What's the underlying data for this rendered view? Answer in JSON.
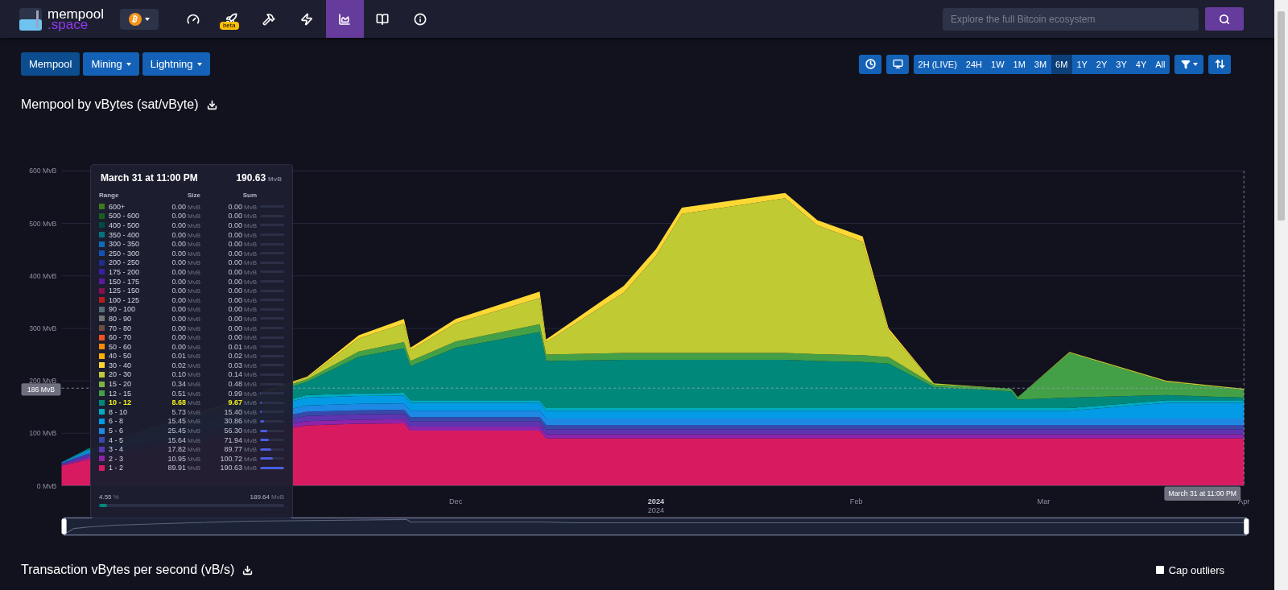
{
  "nav": {
    "logo": {
      "word": "mempool",
      "suffix": ".space"
    },
    "items": [
      {
        "kind": "dashboard",
        "selected": false
      },
      {
        "kind": "accelerator",
        "selected": false,
        "badge": "beta"
      },
      {
        "kind": "mining",
        "selected": false
      },
      {
        "kind": "lightning",
        "selected": false
      },
      {
        "kind": "graphs",
        "selected": true
      },
      {
        "kind": "docs",
        "selected": false
      },
      {
        "kind": "about",
        "selected": false
      }
    ],
    "search": {
      "placeholder": "Explore the full Bitcoin ecosystem"
    }
  },
  "sections": [
    {
      "label": "Mempool",
      "selected": true,
      "dropdown": false
    },
    {
      "label": "Mining",
      "selected": false,
      "dropdown": true
    },
    {
      "label": "Lightning",
      "selected": false,
      "dropdown": true
    }
  ],
  "ranges": [
    {
      "label": "2H (LIVE)",
      "selected": false
    },
    {
      "label": "24H",
      "selected": false
    },
    {
      "label": "1W",
      "selected": false
    },
    {
      "label": "1M",
      "selected": false
    },
    {
      "label": "3M",
      "selected": false
    },
    {
      "label": "6M",
      "selected": true
    },
    {
      "label": "1Y",
      "selected": false
    },
    {
      "label": "2Y",
      "selected": false
    },
    {
      "label": "3Y",
      "selected": false
    },
    {
      "label": "4Y",
      "selected": false
    },
    {
      "label": "All",
      "selected": false
    }
  ],
  "chart_title": "Mempool by vBytes (sat/vByte)",
  "chart": {
    "chart_data": {
      "type": "area",
      "stacked": true,
      "grid": true,
      "ref_lines": [
        {
          "axis": "y",
          "value": 186,
          "label": "186 MvB"
        },
        {
          "axis": "x",
          "value": "2024-04-01",
          "label": "March 31 at 11:00 PM"
        }
      ],
      "x": [
        "2023-10-01",
        "2023-10-05",
        "2023-11-08",
        "2023-11-16",
        "2023-11-23",
        "2023-11-24",
        "2023-12-01",
        "2023-12-14",
        "2023-12-15",
        "2023-12-27",
        "2024-01-01",
        "2024-01-05",
        "2024-01-21",
        "2024-01-26",
        "2024-02-02",
        "2024-02-06",
        "2024-02-13",
        "2024-02-25",
        "2024-02-26",
        "2024-03-05",
        "2024-03-20",
        "2024-04-01"
      ],
      "xlim": [
        "2023-10-01",
        "2024-04-01"
      ],
      "ylim": [
        0,
        600
      ],
      "xticks": [
        {
          "value": "2023-12-01",
          "label": "Dec"
        },
        {
          "value": "2024-01-01",
          "label": "2024"
        },
        {
          "value": "2024-02-01",
          "label": "Feb"
        },
        {
          "value": "2024-03-01",
          "label": "Mar"
        },
        {
          "value": "2024-04-01",
          "label": "Apr"
        }
      ],
      "yticks": [
        {
          "value": 0,
          "label": "0 MvB"
        },
        {
          "value": 100,
          "label": "100 MvB"
        },
        {
          "value": 200,
          "label": "200 MvB"
        },
        {
          "value": 300,
          "label": "300 MvB"
        },
        {
          "value": 400,
          "label": "400 MvB"
        },
        {
          "value": 500,
          "label": "500 MvB"
        },
        {
          "value": 600,
          "label": "600 MvB"
        }
      ],
      "series": [
        {
          "color": "#d81b60",
          "values": [
            38,
            50,
            115,
            118,
            119,
            105,
            105,
            105,
            90,
            90,
            90,
            90,
            90,
            90,
            90,
            90,
            90,
            90,
            90,
            90,
            90,
            90
          ]
        },
        {
          "color": "#8e24aa",
          "values": [
            2,
            4,
            8,
            8,
            8,
            8,
            8,
            8,
            8,
            8,
            8,
            8,
            8,
            8,
            8,
            8,
            8,
            8,
            8,
            8,
            8,
            8
          ]
        },
        {
          "color": "#5e35b1",
          "values": [
            2,
            4,
            10,
            10,
            10,
            10,
            10,
            10,
            10,
            10,
            10,
            10,
            10,
            10,
            10,
            10,
            10,
            10,
            10,
            10,
            10,
            10
          ]
        },
        {
          "color": "#3949ab",
          "values": [
            1,
            3,
            8,
            8,
            8,
            8,
            8,
            8,
            8,
            8,
            8,
            8,
            8,
            8,
            8,
            8,
            8,
            8,
            8,
            8,
            8,
            8
          ]
        },
        {
          "color": "#1e88e5",
          "values": [
            1,
            3,
            12,
            12,
            12,
            12,
            12,
            12,
            12,
            12,
            12,
            12,
            12,
            12,
            12,
            12,
            12,
            12,
            12,
            12,
            12,
            12
          ]
        },
        {
          "color": "#039be5",
          "values": [
            1,
            3,
            15,
            15,
            15,
            15,
            15,
            15,
            15,
            15,
            15,
            15,
            15,
            15,
            15,
            15,
            15,
            15,
            15,
            15,
            30,
            30
          ]
        },
        {
          "color": "#00acc1",
          "values": [
            0,
            1,
            5,
            5,
            5,
            5,
            5,
            5,
            5,
            5,
            5,
            5,
            5,
            5,
            5,
            5,
            5,
            5,
            5,
            5,
            5,
            5
          ]
        },
        {
          "color": "#00897b",
          "values": [
            0,
            2,
            25,
            70,
            85,
            65,
            100,
            130,
            90,
            92,
            92,
            92,
            92,
            90,
            88,
            85,
            40,
            32,
            16,
            20,
            10,
            5
          ]
        },
        {
          "color": "#43a047",
          "values": [
            0,
            0,
            5,
            10,
            12,
            10,
            12,
            15,
            12,
            13,
            13,
            13,
            13,
            13,
            13,
            12,
            5,
            5,
            5,
            85,
            25,
            15
          ]
        },
        {
          "color": "#c0ca33",
          "values": [
            0,
            0,
            3,
            25,
            35,
            20,
            35,
            50,
            24,
            115,
            185,
            265,
            295,
            245,
            216,
            50,
            2,
            0,
            0,
            2,
            2,
            2
          ]
        },
        {
          "color": "#fdd835",
          "values": [
            0,
            0,
            2,
            6,
            9,
            5,
            8,
            12,
            5,
            13,
            13,
            12,
            10,
            10,
            10,
            5,
            0,
            0,
            0,
            0,
            0,
            0
          ]
        }
      ]
    },
    "year_sublabel": "2024"
  },
  "tooltip": {
    "title": "March 31 at 11:00 PM",
    "total": "190.63",
    "total_unit": "MvB",
    "columns": [
      "Range",
      "Size",
      "Sum"
    ],
    "rows": [
      {
        "range": "600+",
        "color": "#3d7a1f",
        "size": "0.00",
        "size_unit": "MvB",
        "sum": "0.00",
        "sum_unit": "MvB",
        "level": 0,
        "selected": false
      },
      {
        "range": "500 - 600",
        "color": "#1b5e20",
        "size": "0.00",
        "size_unit": "MvB",
        "sum": "0.00",
        "sum_unit": "MvB",
        "level": 0,
        "selected": false
      },
      {
        "range": "400 - 500",
        "color": "#004d40",
        "size": "0.00",
        "size_unit": "MvB",
        "sum": "0.00",
        "sum_unit": "MvB",
        "level": 0,
        "selected": false
      },
      {
        "range": "350 - 400",
        "color": "#00757a",
        "size": "0.00",
        "size_unit": "MvB",
        "sum": "0.00",
        "sum_unit": "MvB",
        "level": 0,
        "selected": false
      },
      {
        "range": "300 - 350",
        "color": "#0d6bb8",
        "size": "0.00",
        "size_unit": "MvB",
        "sum": "0.00",
        "sum_unit": "MvB",
        "level": 0,
        "selected": false
      },
      {
        "range": "250 - 300",
        "color": "#1551b5",
        "size": "0.00",
        "size_unit": "MvB",
        "sum": "0.00",
        "sum_unit": "MvB",
        "level": 0,
        "selected": false
      },
      {
        "range": "200 - 250",
        "color": "#222c8e",
        "size": "0.00",
        "size_unit": "MvB",
        "sum": "0.00",
        "sum_unit": "MvB",
        "level": 0,
        "selected": false
      },
      {
        "range": "175 - 200",
        "color": "#3a1fa0",
        "size": "0.00",
        "size_unit": "MvB",
        "sum": "0.00",
        "sum_unit": "MvB",
        "level": 0,
        "selected": false
      },
      {
        "range": "150 - 175",
        "color": "#5a1a9c",
        "size": "0.00",
        "size_unit": "MvB",
        "sum": "0.00",
        "sum_unit": "MvB",
        "level": 0,
        "selected": false
      },
      {
        "range": "125 - 150",
        "color": "#880e4f",
        "size": "0.00",
        "size_unit": "MvB",
        "sum": "0.00",
        "sum_unit": "MvB",
        "level": 0,
        "selected": false
      },
      {
        "range": "100 - 125",
        "color": "#b71c1c",
        "size": "0.00",
        "size_unit": "MvB",
        "sum": "0.00",
        "sum_unit": "MvB",
        "level": 0,
        "selected": false
      },
      {
        "range": "90 - 100",
        "color": "#546e7a",
        "size": "0.00",
        "size_unit": "MvB",
        "sum": "0.00",
        "sum_unit": "MvB",
        "level": 0,
        "selected": false
      },
      {
        "range": "80 - 90",
        "color": "#757575",
        "size": "0.00",
        "size_unit": "MvB",
        "sum": "0.00",
        "sum_unit": "MvB",
        "level": 0,
        "selected": false
      },
      {
        "range": "70 - 80",
        "color": "#6d4c41",
        "size": "0.00",
        "size_unit": "MvB",
        "sum": "0.00",
        "sum_unit": "MvB",
        "level": 0,
        "selected": false
      },
      {
        "range": "60 - 70",
        "color": "#f4511e",
        "size": "0.00",
        "size_unit": "MvB",
        "sum": "0.00",
        "sum_unit": "MvB",
        "level": 0,
        "selected": false
      },
      {
        "range": "50 - 60",
        "color": "#fb8c00",
        "size": "0.00",
        "size_unit": "MvB",
        "sum": "0.01",
        "sum_unit": "MvB",
        "level": 0,
        "selected": false
      },
      {
        "range": "40 - 50",
        "color": "#ffb300",
        "size": "0.01",
        "size_unit": "MvB",
        "sum": "0.02",
        "sum_unit": "MvB",
        "level": 0,
        "selected": false
      },
      {
        "range": "30 - 40",
        "color": "#fdd835",
        "size": "0.02",
        "size_unit": "MvB",
        "sum": "0.03",
        "sum_unit": "MvB",
        "level": 0,
        "selected": false
      },
      {
        "range": "20 - 30",
        "color": "#c0ca33",
        "size": "0.10",
        "size_unit": "MvB",
        "sum": "0.14",
        "sum_unit": "MvB",
        "level": 0,
        "selected": false
      },
      {
        "range": "15 - 20",
        "color": "#7cb342",
        "size": "0.34",
        "size_unit": "MvB",
        "sum": "0.48",
        "sum_unit": "MvB",
        "level": 0,
        "selected": false
      },
      {
        "range": "12 - 15",
        "color": "#43a047",
        "size": "0.51",
        "size_unit": "MvB",
        "sum": "0.99",
        "sum_unit": "MvB",
        "level": 0.01,
        "selected": false
      },
      {
        "range": "10 - 12",
        "color": "#00897b",
        "size": "8.68",
        "size_unit": "MvB",
        "sum": "9.67",
        "sum_unit": "MvB",
        "level": 0.05,
        "selected": true
      },
      {
        "range": "8 - 10",
        "color": "#00acc1",
        "size": "5.73",
        "size_unit": "MvB",
        "sum": "15.40",
        "sum_unit": "MvB",
        "level": 0.08,
        "selected": false
      },
      {
        "range": "6 - 8",
        "color": "#039be5",
        "size": "15.45",
        "size_unit": "MvB",
        "sum": "30.86",
        "sum_unit": "MvB",
        "level": 0.16,
        "selected": false
      },
      {
        "range": "5 - 6",
        "color": "#1e88e5",
        "size": "25.45",
        "size_unit": "MvB",
        "sum": "56.30",
        "sum_unit": "MvB",
        "level": 0.3,
        "selected": false
      },
      {
        "range": "4 - 5",
        "color": "#3949ab",
        "size": "15.64",
        "size_unit": "MvB",
        "sum": "71.94",
        "sum_unit": "MvB",
        "level": 0.38,
        "selected": false
      },
      {
        "range": "3 - 4",
        "color": "#5e35b1",
        "size": "17.82",
        "size_unit": "MvB",
        "sum": "89.77",
        "sum_unit": "MvB",
        "level": 0.47,
        "selected": false
      },
      {
        "range": "2 - 3",
        "color": "#8e24aa",
        "size": "10.95",
        "size_unit": "MvB",
        "sum": "100.72",
        "sum_unit": "MvB",
        "level": 0.53,
        "selected": false
      },
      {
        "range": "1 - 2",
        "color": "#d81b60",
        "size": "89.91",
        "size_unit": "MvB",
        "sum": "190.63",
        "sum_unit": "MvB",
        "level": 1,
        "selected": false
      }
    ],
    "footer": {
      "percent": "4.55",
      "percent_unit": "%",
      "total": "189.64",
      "total_unit": "MvB",
      "level": 0.0455
    }
  },
  "next_title": "Transaction vBytes per second (vB/s)",
  "cap_outliers": {
    "label": "Cap outliers",
    "checked": false
  }
}
